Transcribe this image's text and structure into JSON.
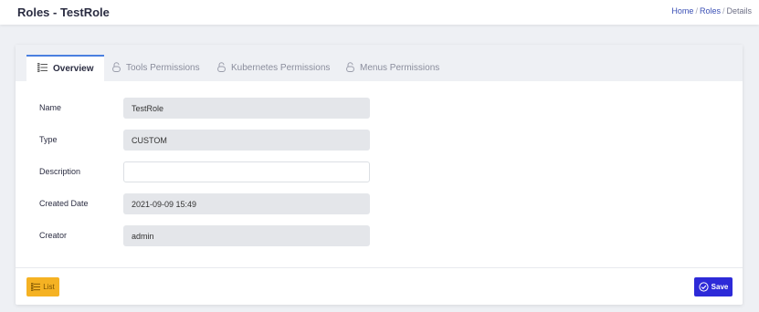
{
  "header": {
    "title": "Roles - TestRole",
    "breadcrumb": {
      "home": "Home",
      "roles": "Roles",
      "current": "Details",
      "separator": "/"
    }
  },
  "tabs": [
    {
      "label": "Overview",
      "icon": "list-icon",
      "active": true
    },
    {
      "label": "Tools Permissions",
      "icon": "lock-icon",
      "active": false
    },
    {
      "label": "Kubernetes Permissions",
      "icon": "lock-icon",
      "active": false
    },
    {
      "label": "Menus Permissions",
      "icon": "lock-icon",
      "active": false
    }
  ],
  "form": {
    "name": {
      "label": "Name",
      "value": "TestRole"
    },
    "type": {
      "label": "Type",
      "value": "CUSTOM"
    },
    "description": {
      "label": "Description",
      "value": ""
    },
    "created_date": {
      "label": "Created Date",
      "value": "2021-09-09 15:49"
    },
    "creator": {
      "label": "Creator",
      "value": "admin"
    }
  },
  "footer": {
    "list_label": "List",
    "list_icon": "list-icon",
    "save_label": "Save",
    "save_icon": "check-circle-icon"
  },
  "colors": {
    "accent": "#4a7fe0",
    "list_button": "#f5b223",
    "save_button": "#2d2ad8",
    "link": "#3a4fb5"
  }
}
